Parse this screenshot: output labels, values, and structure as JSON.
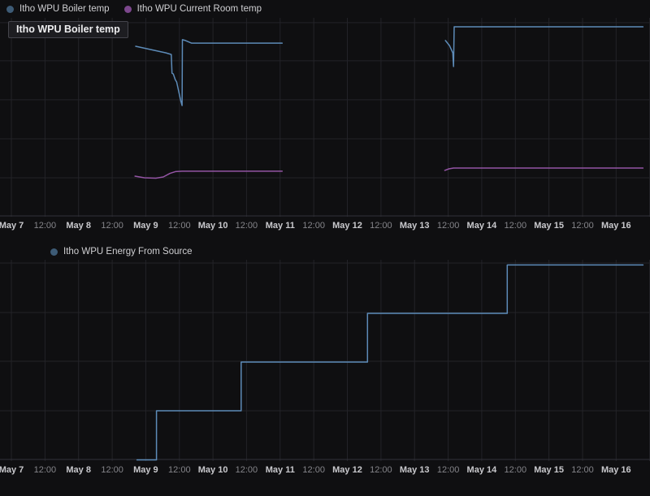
{
  "tooltip": {
    "text": "Itho WPU Boiler temp"
  },
  "colors": {
    "background": "#0f0f11",
    "grid": "#232328",
    "axis_line": "#32323a",
    "tick_major": "#c9c9cd",
    "tick_minor": "#85858a",
    "legend_text": "#cfcfd2",
    "tooltip_bg": "#1d1d21",
    "tooltip_border": "#45454c",
    "boiler_line": "#5d8bb8",
    "room_line": "#9455a5",
    "energy_line": "#5d8bb8",
    "legend_dot_blue": "#3d5b76",
    "legend_dot_purple": "#7c478d"
  },
  "chart_data": [
    {
      "type": "line",
      "title": "",
      "legend_position": "top-left",
      "grid": true,
      "tooltip_text": "Itho WPU Boiler temp",
      "x_axis": {
        "kind": "time",
        "grid_start_day": 7,
        "grid_end_day": 16.5,
        "grid_step_days": 0.5,
        "visible_range_days": [
          6.83,
          16.5
        ],
        "month": "May"
      },
      "y_axis": {
        "tick_labels_visible": false,
        "unit": "fraction_of_plot_height_from_top",
        "gridline_fracs": [
          0.024,
          0.216,
          0.412,
          0.608,
          0.804,
          0.996
        ]
      },
      "x_ticks": [
        {
          "label": "May 7",
          "day": 7,
          "major": true
        },
        {
          "label": "12:00",
          "day": 7.5,
          "major": false
        },
        {
          "label": "May 8",
          "day": 8,
          "major": true
        },
        {
          "label": "12:00",
          "day": 8.5,
          "major": false
        },
        {
          "label": "May 9",
          "day": 9,
          "major": true
        },
        {
          "label": "12:00",
          "day": 9.5,
          "major": false
        },
        {
          "label": "May 10",
          "day": 10,
          "major": true
        },
        {
          "label": "12:00",
          "day": 10.5,
          "major": false
        },
        {
          "label": "May 11",
          "day": 11,
          "major": true
        },
        {
          "label": "12:00",
          "day": 11.5,
          "major": false
        },
        {
          "label": "May 12",
          "day": 12,
          "major": true
        },
        {
          "label": "12:00",
          "day": 12.5,
          "major": false
        },
        {
          "label": "May 13",
          "day": 13,
          "major": true
        },
        {
          "label": "12:00",
          "day": 13.5,
          "major": false
        },
        {
          "label": "May 14",
          "day": 14,
          "major": true
        },
        {
          "label": "12:00",
          "day": 14.5,
          "major": false
        },
        {
          "label": "May 15",
          "day": 15,
          "major": true
        },
        {
          "label": "12:00",
          "day": 15.5,
          "major": false
        },
        {
          "label": "May 16",
          "day": 16,
          "major": true
        }
      ],
      "series": [
        {
          "name": "Itho WPU Boiler temp",
          "color": "#5d8bb8",
          "legend_color": "#3d5b76",
          "segments": [
            [
              [
                8.85,
                0.143
              ],
              [
                9.3,
                0.176
              ],
              [
                9.38,
                0.184
              ],
              [
                9.39,
                0.278
              ],
              [
                9.41,
                0.282
              ],
              [
                9.44,
                0.312
              ],
              [
                9.46,
                0.322
              ],
              [
                9.52,
                0.416
              ],
              [
                9.54,
                0.441
              ],
              [
                9.545,
                0.11
              ],
              [
                9.59,
                0.114
              ],
              [
                9.68,
                0.127
              ],
              [
                11.03,
                0.127
              ]
            ],
            [
              [
                13.46,
                0.114
              ],
              [
                13.52,
                0.139
              ],
              [
                13.57,
                0.176
              ],
              [
                13.58,
                0.245
              ],
              [
                13.59,
                0.045
              ],
              [
                16.4,
                0.045
              ]
            ]
          ]
        },
        {
          "name": "Itho WPU Current Room temp",
          "color": "#9455a5",
          "legend_color": "#7c478d",
          "segments": [
            [
              [
                8.84,
                0.796
              ],
              [
                8.98,
                0.804
              ],
              [
                9.15,
                0.806
              ],
              [
                9.26,
                0.8
              ],
              [
                9.36,
                0.782
              ],
              [
                9.44,
                0.773
              ],
              [
                9.54,
                0.771
              ],
              [
                11.03,
                0.771
              ]
            ],
            [
              [
                13.45,
                0.767
              ],
              [
                13.51,
                0.759
              ],
              [
                13.58,
                0.755
              ],
              [
                16.4,
                0.755
              ]
            ]
          ]
        }
      ]
    },
    {
      "type": "line",
      "line_style": "step",
      "title": "",
      "legend_position": "top-left",
      "grid": true,
      "x_axis": {
        "kind": "time",
        "grid_start_day": 7,
        "grid_end_day": 16.5,
        "grid_step_days": 0.5,
        "visible_range_days": [
          6.83,
          16.5
        ],
        "month": "May"
      },
      "y_axis": {
        "tick_labels_visible": false,
        "unit": "fraction_of_plot_height_from_top",
        "gridline_fracs": [
          0.016,
          0.262,
          0.504,
          0.75,
          0.992
        ]
      },
      "x_ticks": [
        {
          "label": "May 7",
          "day": 7,
          "major": true
        },
        {
          "label": "12:00",
          "day": 7.5,
          "major": false
        },
        {
          "label": "May 8",
          "day": 8,
          "major": true
        },
        {
          "label": "12:00",
          "day": 8.5,
          "major": false
        },
        {
          "label": "May 9",
          "day": 9,
          "major": true
        },
        {
          "label": "12:00",
          "day": 9.5,
          "major": false
        },
        {
          "label": "May 10",
          "day": 10,
          "major": true
        },
        {
          "label": "12:00",
          "day": 10.5,
          "major": false
        },
        {
          "label": "May 11",
          "day": 11,
          "major": true
        },
        {
          "label": "12:00",
          "day": 11.5,
          "major": false
        },
        {
          "label": "May 12",
          "day": 12,
          "major": true
        },
        {
          "label": "12:00",
          "day": 12.5,
          "major": false
        },
        {
          "label": "May 13",
          "day": 13,
          "major": true
        },
        {
          "label": "12:00",
          "day": 13.5,
          "major": false
        },
        {
          "label": "May 14",
          "day": 14,
          "major": true
        },
        {
          "label": "12:00",
          "day": 14.5,
          "major": false
        },
        {
          "label": "May 15",
          "day": 15,
          "major": true
        },
        {
          "label": "12:00",
          "day": 15.5,
          "major": false
        },
        {
          "label": "May 16",
          "day": 16,
          "major": true
        }
      ],
      "series": [
        {
          "name": "Itho WPU Energy From Source",
          "color": "#5d8bb8",
          "legend_color": "#3d5b76",
          "segments": [
            [
              [
                8.87,
                0.994
              ],
              [
                9.16,
                0.994
              ],
              [
                9.16,
                0.75
              ],
              [
                10.42,
                0.75
              ],
              [
                10.42,
                0.508
              ],
              [
                12.3,
                0.508
              ],
              [
                12.3,
                0.266
              ],
              [
                14.38,
                0.266
              ],
              [
                14.38,
                0.026
              ],
              [
                16.4,
                0.026
              ]
            ]
          ]
        }
      ]
    }
  ]
}
